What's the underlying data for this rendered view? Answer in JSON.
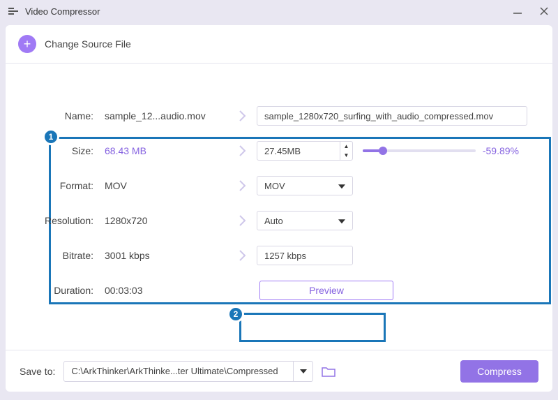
{
  "window": {
    "title": "Video Compressor"
  },
  "header": {
    "change_source": "Change Source File"
  },
  "labels": {
    "name": "Name:",
    "size": "Size:",
    "format": "Format:",
    "resolution": "Resolution:",
    "bitrate": "Bitrate:",
    "duration": "Duration:"
  },
  "original": {
    "name": "sample_12...audio.mov",
    "size": "68.43 MB",
    "format": "MOV",
    "resolution": "1280x720",
    "bitrate": "3001 kbps",
    "duration": "00:03:03"
  },
  "output": {
    "name": "sample_1280x720_surfing_with_audio_compressed.mov",
    "size": "27.45MB",
    "format": "MOV",
    "resolution": "Auto",
    "bitrate": "1257 kbps"
  },
  "compression": {
    "percent": "-59.89%"
  },
  "buttons": {
    "preview": "Preview",
    "compress": "Compress"
  },
  "footer": {
    "save_to_label": "Save to:",
    "save_path": "C:\\ArkThinker\\ArkThinke...ter Ultimate\\Compressed"
  },
  "annotations": {
    "badge1": "1",
    "badge2": "2"
  }
}
